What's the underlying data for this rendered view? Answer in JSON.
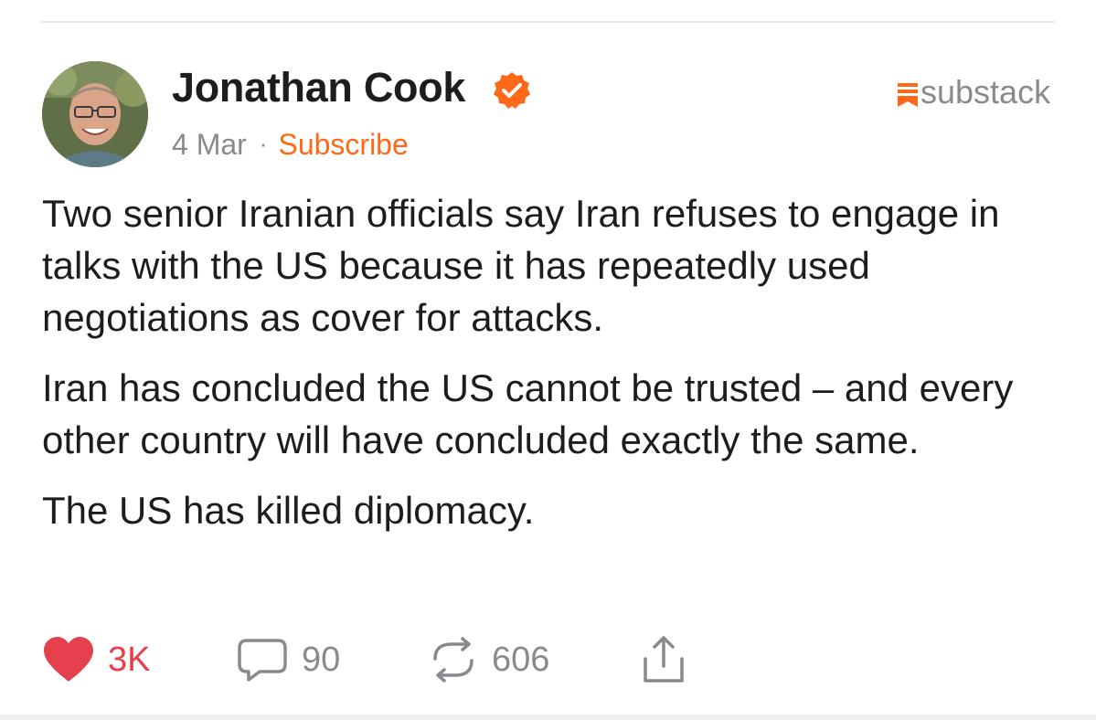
{
  "post": {
    "author_name": "Jonathan Cook",
    "date": "4 Mar",
    "separator": "·",
    "subscribe_label": "Subscribe",
    "platform": "substack",
    "paragraphs": [
      "Two senior Iranian officials say Iran refuses to engage in talks with the US because it has repeatedly used negotiations as cover for attacks.",
      "Iran has concluded the US cannot be trusted – and every other country will have concluded exactly the same.",
      "The US has killed diplomacy."
    ]
  },
  "actions": {
    "likes": "3K",
    "comments": "90",
    "restacks": "606"
  },
  "icons": {
    "verified": "verified-badge-icon",
    "platform": "substack-logo-icon",
    "like": "heart-icon",
    "comment": "comment-bubble-icon",
    "restack": "restack-arrows-icon",
    "share": "share-icon"
  },
  "colors": {
    "accent": "#ff6719",
    "like": "#e6404e",
    "muted": "#8a8a8e",
    "text": "#1d1d1f"
  }
}
